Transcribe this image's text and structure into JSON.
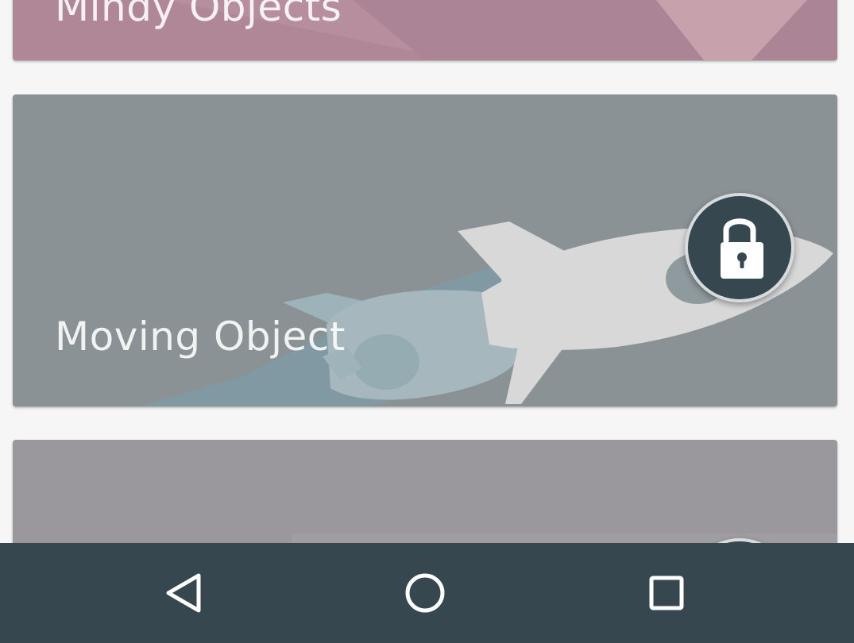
{
  "cards": [
    {
      "title": "Mindy Objects",
      "color": "#b08797",
      "locked": false
    },
    {
      "title": "Moving Object",
      "color": "#8a9296",
      "illustration": "rocket",
      "locked": true,
      "lock_icon": "unlocked-padlock-icon"
    },
    {
      "title": "",
      "color": "#9a989c",
      "locked": true,
      "lock_icon": "unlocked-padlock-icon"
    }
  ],
  "navigation_bar": {
    "color": "#37474f",
    "buttons": [
      {
        "name": "back",
        "icon": "triangle-back-icon"
      },
      {
        "name": "home",
        "icon": "circle-home-icon"
      },
      {
        "name": "recents",
        "icon": "square-recents-icon"
      }
    ]
  }
}
